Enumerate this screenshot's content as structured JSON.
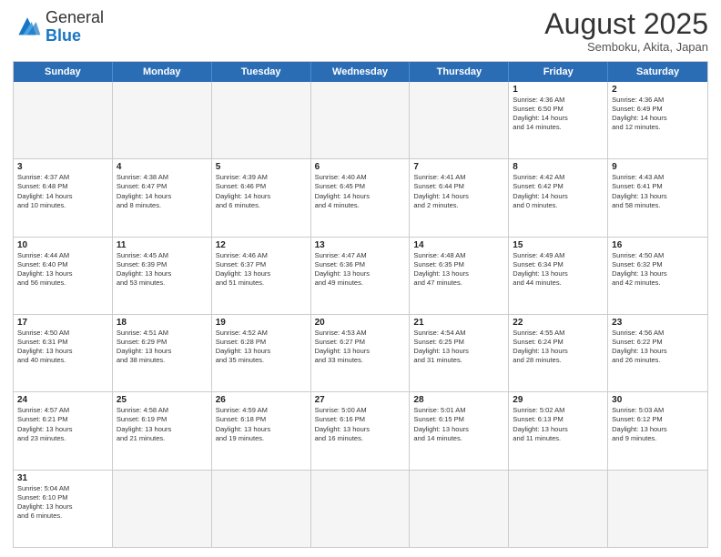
{
  "header": {
    "logo_general": "General",
    "logo_blue": "Blue",
    "month_title": "August 2025",
    "location": "Semboku, Akita, Japan"
  },
  "weekdays": [
    "Sunday",
    "Monday",
    "Tuesday",
    "Wednesday",
    "Thursday",
    "Friday",
    "Saturday"
  ],
  "rows": [
    [
      {
        "day": "",
        "info": "",
        "empty": true
      },
      {
        "day": "",
        "info": "",
        "empty": true
      },
      {
        "day": "",
        "info": "",
        "empty": true
      },
      {
        "day": "",
        "info": "",
        "empty": true
      },
      {
        "day": "",
        "info": "",
        "empty": true
      },
      {
        "day": "1",
        "info": "Sunrise: 4:36 AM\nSunset: 6:50 PM\nDaylight: 14 hours\nand 14 minutes.",
        "empty": false
      },
      {
        "day": "2",
        "info": "Sunrise: 4:36 AM\nSunset: 6:49 PM\nDaylight: 14 hours\nand 12 minutes.",
        "empty": false
      }
    ],
    [
      {
        "day": "3",
        "info": "Sunrise: 4:37 AM\nSunset: 6:48 PM\nDaylight: 14 hours\nand 10 minutes.",
        "empty": false
      },
      {
        "day": "4",
        "info": "Sunrise: 4:38 AM\nSunset: 6:47 PM\nDaylight: 14 hours\nand 8 minutes.",
        "empty": false
      },
      {
        "day": "5",
        "info": "Sunrise: 4:39 AM\nSunset: 6:46 PM\nDaylight: 14 hours\nand 6 minutes.",
        "empty": false
      },
      {
        "day": "6",
        "info": "Sunrise: 4:40 AM\nSunset: 6:45 PM\nDaylight: 14 hours\nand 4 minutes.",
        "empty": false
      },
      {
        "day": "7",
        "info": "Sunrise: 4:41 AM\nSunset: 6:44 PM\nDaylight: 14 hours\nand 2 minutes.",
        "empty": false
      },
      {
        "day": "8",
        "info": "Sunrise: 4:42 AM\nSunset: 6:42 PM\nDaylight: 14 hours\nand 0 minutes.",
        "empty": false
      },
      {
        "day": "9",
        "info": "Sunrise: 4:43 AM\nSunset: 6:41 PM\nDaylight: 13 hours\nand 58 minutes.",
        "empty": false
      }
    ],
    [
      {
        "day": "10",
        "info": "Sunrise: 4:44 AM\nSunset: 6:40 PM\nDaylight: 13 hours\nand 56 minutes.",
        "empty": false
      },
      {
        "day": "11",
        "info": "Sunrise: 4:45 AM\nSunset: 6:39 PM\nDaylight: 13 hours\nand 53 minutes.",
        "empty": false
      },
      {
        "day": "12",
        "info": "Sunrise: 4:46 AM\nSunset: 6:37 PM\nDaylight: 13 hours\nand 51 minutes.",
        "empty": false
      },
      {
        "day": "13",
        "info": "Sunrise: 4:47 AM\nSunset: 6:36 PM\nDaylight: 13 hours\nand 49 minutes.",
        "empty": false
      },
      {
        "day": "14",
        "info": "Sunrise: 4:48 AM\nSunset: 6:35 PM\nDaylight: 13 hours\nand 47 minutes.",
        "empty": false
      },
      {
        "day": "15",
        "info": "Sunrise: 4:49 AM\nSunset: 6:34 PM\nDaylight: 13 hours\nand 44 minutes.",
        "empty": false
      },
      {
        "day": "16",
        "info": "Sunrise: 4:50 AM\nSunset: 6:32 PM\nDaylight: 13 hours\nand 42 minutes.",
        "empty": false
      }
    ],
    [
      {
        "day": "17",
        "info": "Sunrise: 4:50 AM\nSunset: 6:31 PM\nDaylight: 13 hours\nand 40 minutes.",
        "empty": false
      },
      {
        "day": "18",
        "info": "Sunrise: 4:51 AM\nSunset: 6:29 PM\nDaylight: 13 hours\nand 38 minutes.",
        "empty": false
      },
      {
        "day": "19",
        "info": "Sunrise: 4:52 AM\nSunset: 6:28 PM\nDaylight: 13 hours\nand 35 minutes.",
        "empty": false
      },
      {
        "day": "20",
        "info": "Sunrise: 4:53 AM\nSunset: 6:27 PM\nDaylight: 13 hours\nand 33 minutes.",
        "empty": false
      },
      {
        "day": "21",
        "info": "Sunrise: 4:54 AM\nSunset: 6:25 PM\nDaylight: 13 hours\nand 31 minutes.",
        "empty": false
      },
      {
        "day": "22",
        "info": "Sunrise: 4:55 AM\nSunset: 6:24 PM\nDaylight: 13 hours\nand 28 minutes.",
        "empty": false
      },
      {
        "day": "23",
        "info": "Sunrise: 4:56 AM\nSunset: 6:22 PM\nDaylight: 13 hours\nand 26 minutes.",
        "empty": false
      }
    ],
    [
      {
        "day": "24",
        "info": "Sunrise: 4:57 AM\nSunset: 6:21 PM\nDaylight: 13 hours\nand 23 minutes.",
        "empty": false
      },
      {
        "day": "25",
        "info": "Sunrise: 4:58 AM\nSunset: 6:19 PM\nDaylight: 13 hours\nand 21 minutes.",
        "empty": false
      },
      {
        "day": "26",
        "info": "Sunrise: 4:59 AM\nSunset: 6:18 PM\nDaylight: 13 hours\nand 19 minutes.",
        "empty": false
      },
      {
        "day": "27",
        "info": "Sunrise: 5:00 AM\nSunset: 6:16 PM\nDaylight: 13 hours\nand 16 minutes.",
        "empty": false
      },
      {
        "day": "28",
        "info": "Sunrise: 5:01 AM\nSunset: 6:15 PM\nDaylight: 13 hours\nand 14 minutes.",
        "empty": false
      },
      {
        "day": "29",
        "info": "Sunrise: 5:02 AM\nSunset: 6:13 PM\nDaylight: 13 hours\nand 11 minutes.",
        "empty": false
      },
      {
        "day": "30",
        "info": "Sunrise: 5:03 AM\nSunset: 6:12 PM\nDaylight: 13 hours\nand 9 minutes.",
        "empty": false
      }
    ],
    [
      {
        "day": "31",
        "info": "Sunrise: 5:04 AM\nSunset: 6:10 PM\nDaylight: 13 hours\nand 6 minutes.",
        "empty": false
      },
      {
        "day": "",
        "info": "",
        "empty": true
      },
      {
        "day": "",
        "info": "",
        "empty": true
      },
      {
        "day": "",
        "info": "",
        "empty": true
      },
      {
        "day": "",
        "info": "",
        "empty": true
      },
      {
        "day": "",
        "info": "",
        "empty": true
      },
      {
        "day": "",
        "info": "",
        "empty": true
      }
    ]
  ]
}
